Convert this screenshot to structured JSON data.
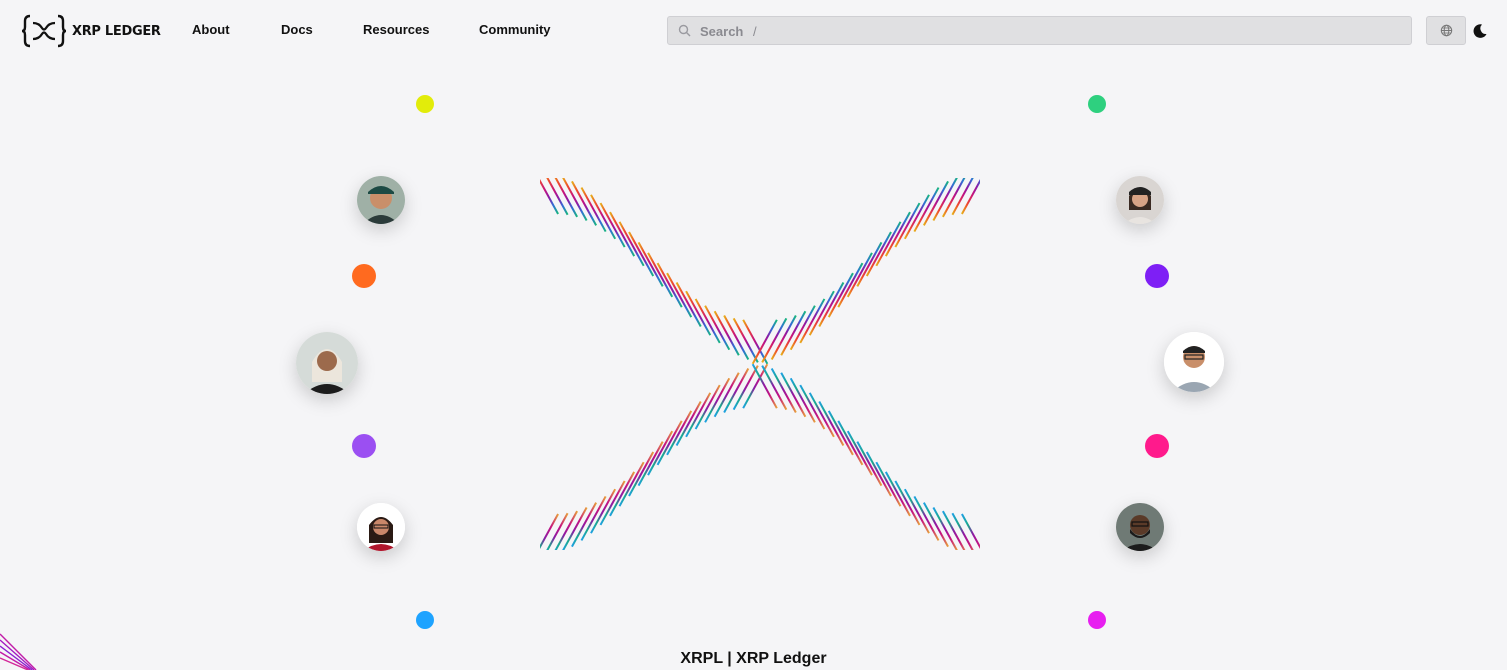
{
  "brand": {
    "logo_text": "XRP LEDGER"
  },
  "nav": {
    "items": [
      {
        "label": "About"
      },
      {
        "label": "Docs"
      },
      {
        "label": "Resources"
      },
      {
        "label": "Community"
      }
    ]
  },
  "search": {
    "placeholder": "Search",
    "shortcut": "/"
  },
  "icons": {
    "search": "search-icon",
    "language": "globe-icon",
    "theme": "moon-icon"
  },
  "hero": {
    "title": "XRPL | XRP Ledger"
  },
  "colors": {
    "background": "#f5f5f7",
    "dot_yellow": "#e2ec0a",
    "dot_green": "#2ed07f",
    "dot_orange": "#ff6a1f",
    "dot_violet": "#7e1ff5",
    "dot_lilac": "#9b4ff2",
    "dot_pink": "#ff1a8c",
    "dot_blue": "#1ea3ff",
    "dot_magenta": "#e71ff0"
  }
}
